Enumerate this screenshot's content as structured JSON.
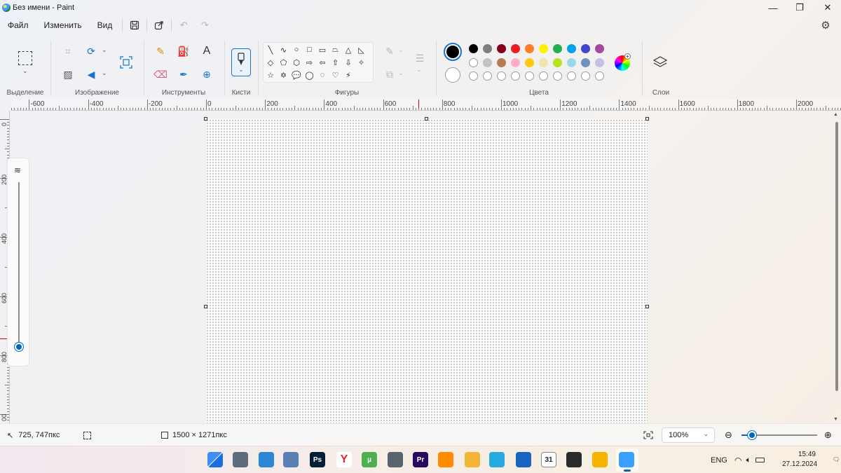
{
  "window": {
    "title": "Без имени - Paint",
    "controls": {
      "minimize": "—",
      "maximize": "❐",
      "close": "✕"
    }
  },
  "menu": {
    "items": [
      "Файл",
      "Изменить",
      "Вид"
    ],
    "icons": [
      "save-icon",
      "share-icon",
      "undo-icon",
      "redo-icon",
      "settings-icon"
    ]
  },
  "ribbon": {
    "groups": {
      "selection": "Выделение",
      "image": "Изображение",
      "tools": "Инструменты",
      "brushes": "Кисти",
      "shapes": "Фигуры",
      "colors": "Цвета",
      "layers": "Слои"
    },
    "text_tool_glyph": "A",
    "shapes": [
      "╲",
      "∿",
      "○",
      "□",
      "▭",
      "⏢",
      "△",
      "◺",
      "◇",
      "⬠",
      "⬡",
      "⇨",
      "⇦",
      "⇧",
      "⇩",
      "✧",
      "☆",
      "✡",
      "💬",
      "◯",
      "◌",
      "♡",
      "⚡"
    ],
    "colors": {
      "primary": "#000000",
      "secondary": "#ffffff",
      "row1": [
        "#000000",
        "#7f7f7f",
        "#880015",
        "#ed1c24",
        "#ff7f27",
        "#fff200",
        "#22b14c",
        "#00a2e8",
        "#3f48cc",
        "#a349a4"
      ],
      "row2": [
        "#ffffff",
        "#c3c3c3",
        "#b97a57",
        "#ffaec9",
        "#ffc90e",
        "#efe4b0",
        "#b5e61d",
        "#99d9ea",
        "#7092be",
        "#c8bfe7"
      ],
      "row3_count": 10
    }
  },
  "rulers": {
    "horizontal": [
      "-600",
      "-400",
      "-200",
      "0",
      "200",
      "400",
      "600",
      "800",
      "1000",
      "1200",
      "1400",
      "1600",
      "1800",
      "2000"
    ],
    "vertical": [
      "0",
      "200",
      "400",
      "600",
      "800",
      "00"
    ]
  },
  "zoom_slider_icon": "layers-stack-icon",
  "status": {
    "cursor_position": "725, 747пкс",
    "canvas_size": "1500 × 1271пкс",
    "zoom_level": "100%",
    "zoom_fraction": 0.14
  },
  "taskbar": {
    "apps": [
      "windows-start",
      "settings",
      "photos",
      "charts",
      "photoshop",
      "yandex-browser",
      "utorrent",
      "calculator",
      "premiere",
      "torch",
      "file-explorer",
      "paint3d",
      "security",
      "calendar",
      "terminal",
      "chrome-canary",
      "paint"
    ],
    "app_labels": {
      "photoshop": "Ps",
      "premiere": "Pr",
      "utorrent": "µ",
      "calendar": "31"
    },
    "language": "ENG",
    "time": "15:49",
    "date": "27.12.2024"
  }
}
